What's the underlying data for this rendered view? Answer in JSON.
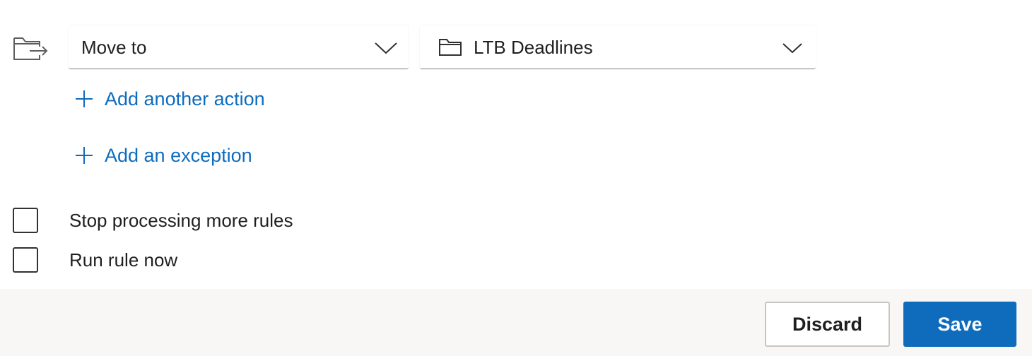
{
  "action": {
    "icon": "move-to-folder-icon",
    "selected_action": "Move to",
    "chevron_icon": "chevron-down-icon"
  },
  "folder": {
    "icon": "folder-icon",
    "selected_folder": "LTB Deadlines",
    "chevron_icon": "chevron-down-icon"
  },
  "links": {
    "add_action_label": "Add another action",
    "add_exception_label": "Add an exception",
    "icon": "plus-icon"
  },
  "options": {
    "stop_processing_label": "Stop processing more rules",
    "stop_processing_checked": false,
    "run_rule_now_label": "Run rule now",
    "run_rule_now_checked": false
  },
  "footer": {
    "discard_label": "Discard",
    "save_label": "Save"
  },
  "colors": {
    "accent": "#0f6cbd",
    "footer_bg": "#f8f7f6",
    "text": "#201f1e"
  }
}
